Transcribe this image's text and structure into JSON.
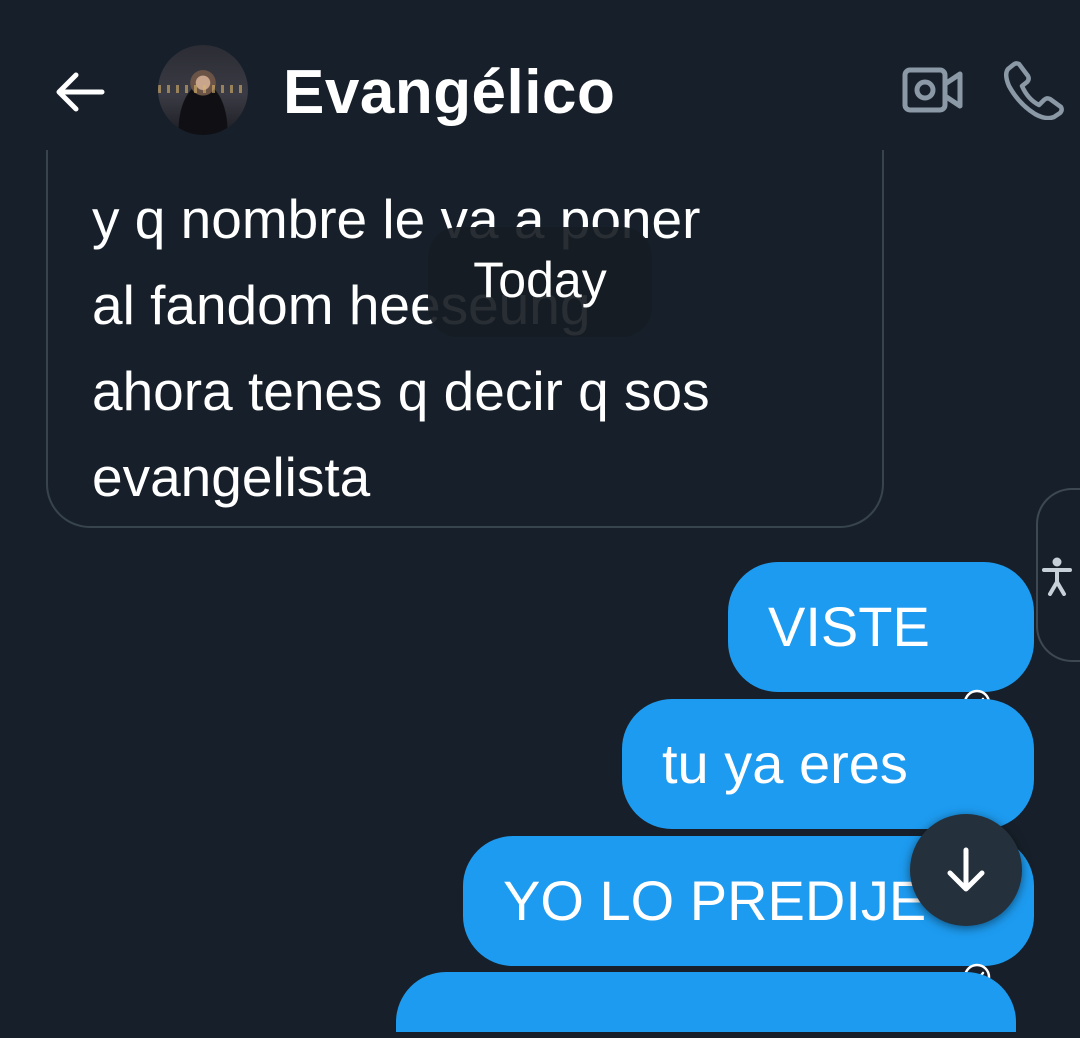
{
  "header": {
    "contact_name": "Evangélico",
    "icons": [
      "back-arrow-icon",
      "video-call-icon",
      "phone-call-icon"
    ]
  },
  "divider": {
    "label": "Today"
  },
  "received_message": {
    "lines": [
      "y q nombre le va a poner",
      "al fandom heeseung",
      "ahora tenes q decir q sos",
      "evangelista"
    ]
  },
  "sent_messages": [
    {
      "text": "VISTE",
      "status": "read"
    },
    {
      "text": "tu ya eres",
      "status": "read"
    },
    {
      "text": "YO LO PREDIJE",
      "status": "read"
    }
  ],
  "colors": {
    "background": "#17202a",
    "sent_bubble": "#1d9bf0",
    "received_border": "#38444d",
    "icon_muted": "#8b98a5"
  }
}
